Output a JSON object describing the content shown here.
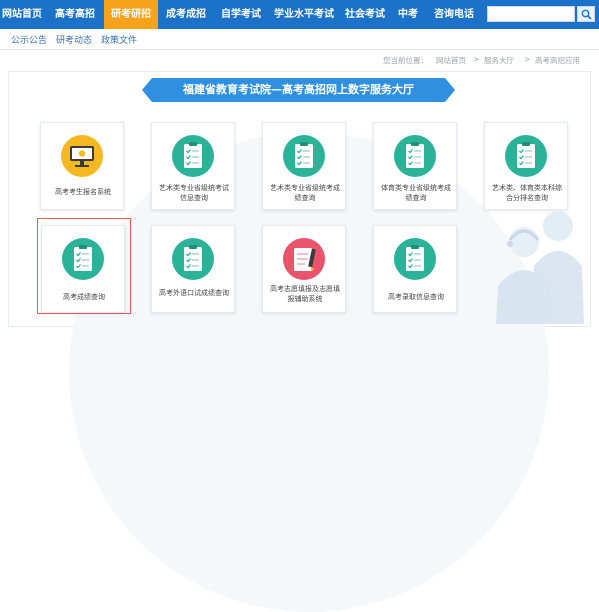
{
  "nav": {
    "items": [
      {
        "label": "网站首页",
        "active": false
      },
      {
        "label": "高考高招",
        "active": false
      },
      {
        "label": "研考研招",
        "active": true
      },
      {
        "label": "成考成招",
        "active": false
      },
      {
        "label": "自学考试",
        "active": false
      },
      {
        "label": "学业水平考试",
        "active": false
      },
      {
        "label": "社会考试",
        "active": false
      },
      {
        "label": "中考",
        "active": false
      },
      {
        "label": "咨询电话",
        "active": false
      }
    ],
    "search_placeholder": "",
    "search_icon": "search-icon"
  },
  "subnav": {
    "items": [
      "公示公告",
      "研考动态",
      "政策文件"
    ]
  },
  "breadcrumb": {
    "prefix": "您当前位置：",
    "items": [
      "网站首页",
      "服务大厅",
      "高考高招应用"
    ],
    "separator": ">"
  },
  "banner": {
    "title": "福建省教育考试院—高考高招网上数字服务大厅"
  },
  "tiles": [
    {
      "label": "高考考生报名系统",
      "icon": "monitor-icon"
    },
    {
      "label": "艺术类专业省级统考试信息查询",
      "icon": "checklist-icon"
    },
    {
      "label": "艺术类专业省级统考成绩查询",
      "icon": "checklist-icon"
    },
    {
      "label": "体育类专业省级统考成绩查询",
      "icon": "checklist-icon"
    },
    {
      "label": "艺术类、体育类本科综合分排名查询",
      "icon": "checklist-icon"
    },
    {
      "label": "高考成绩查询",
      "icon": "checklist-icon"
    },
    {
      "label": "高考外语口试成绩查询",
      "icon": "checklist-icon"
    },
    {
      "label": "高考志愿填报及志愿填报辅助系统",
      "icon": "pencil-icon"
    },
    {
      "label": "高考录取信息查询",
      "icon": "checklist-icon"
    }
  ],
  "colors": {
    "nav_bg": "#1b72c8",
    "nav_active": "#f7a21b",
    "banner": "#2f8fe0",
    "icon_green": "#2bb39a",
    "icon_red": "#e9536b",
    "icon_yellow": "#f5b820",
    "highlight": "#e45a5a"
  }
}
